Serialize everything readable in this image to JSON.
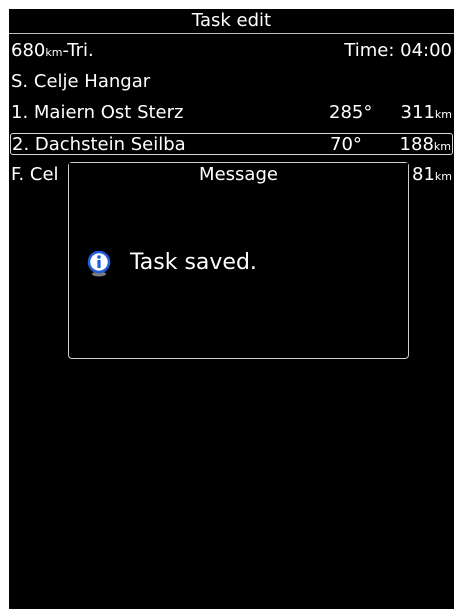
{
  "window": {
    "title": "Task edit"
  },
  "task": {
    "name_number": "680",
    "name_unit": "km",
    "name_suffix": "-Tri.",
    "time_label": "Time: 04:00",
    "start": "S. Celje Hangar",
    "turnpoints": [
      {
        "label": "1. Maiern Ost Sterz",
        "bearing": "285°",
        "distance": "311",
        "unit": "km"
      },
      {
        "label": "2. Dachstein Seilba",
        "bearing": "70°",
        "distance": "188",
        "unit": "km"
      }
    ],
    "finish": {
      "label": "F. Cel",
      "distance": "81",
      "unit": "km"
    }
  },
  "message": {
    "title": "Message",
    "icon": "info-icon",
    "text": "Task saved."
  },
  "colors": {
    "background": "#000000",
    "text": "#ffffff",
    "frame": "#ffffff",
    "icon_blue": "#1f5ddb"
  }
}
